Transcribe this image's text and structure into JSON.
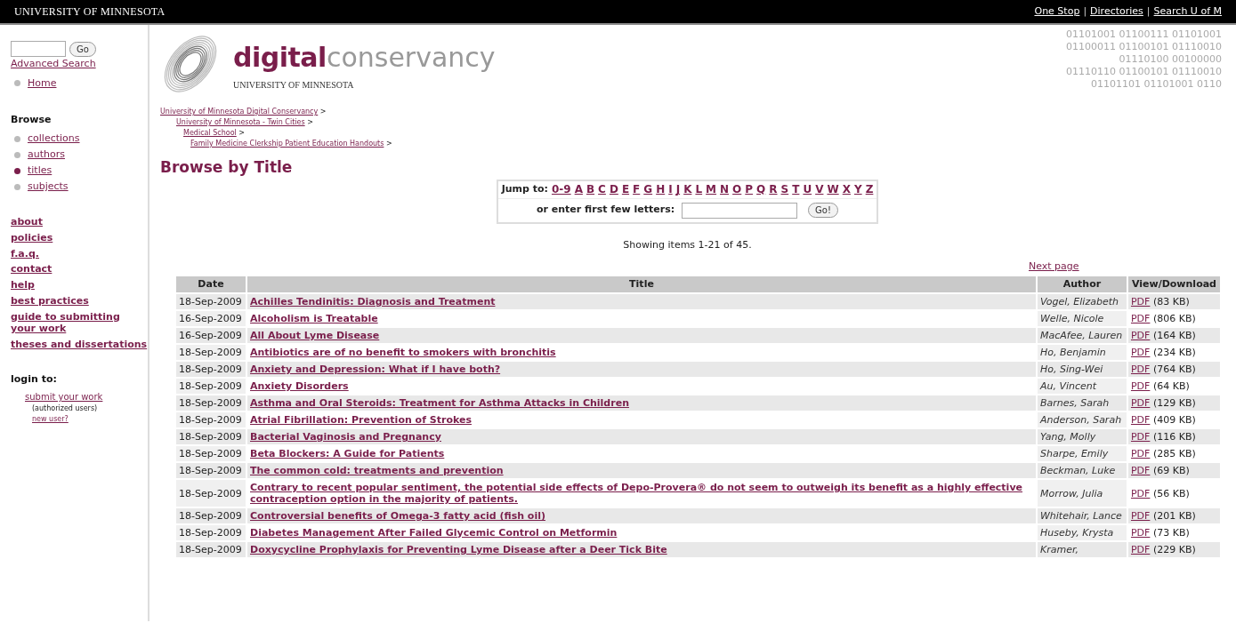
{
  "top_bar": {
    "title": "UNIVERSITY OF MINNESOTA",
    "links": [
      "One Stop",
      "Directories",
      "Search U of M"
    ],
    "separator": "|"
  },
  "sidebar": {
    "search_button": "Go",
    "advanced_search": "Advanced Search",
    "home": [
      {
        "label": "Home",
        "selected": false
      }
    ],
    "browse_heading": "Browse",
    "browse_items": [
      {
        "label": "collections",
        "selected": false
      },
      {
        "label": "authors",
        "selected": false
      },
      {
        "label": "titles",
        "selected": true
      },
      {
        "label": "subjects",
        "selected": false
      }
    ],
    "links": [
      "about",
      "policies",
      "f.a.q.",
      "contact",
      "help",
      "best practices",
      "guide to submitting your work",
      "theses and dissertations"
    ],
    "login_heading": "login to:",
    "submit_link": "submit your work",
    "submit_note": "(authorized users)",
    "new_user": "new user?"
  },
  "header": {
    "logo_bold": "digital",
    "logo_light": "conservancy",
    "logo_sub": "UNIVERSITY OF MINNESOTA",
    "binary_lines": [
      "01101001 01100111 01101001",
      "01100011 01100101 01110010",
      "01110100 00100000",
      "01110110 01100101 01110010",
      "01101101 01101001 0110"
    ]
  },
  "breadcrumbs": [
    {
      "label": "University of Minnesota Digital Conservancy",
      "suffix": ">"
    },
    {
      "label": "University of Minnesota - Twin Cities",
      "suffix": ">"
    },
    {
      "label": "Medical School",
      "suffix": ">"
    },
    {
      "label": "Family Medicine Clerkship Patient Education Handouts",
      "suffix": ">"
    }
  ],
  "page_title": "Browse by Title",
  "jump": {
    "label": "Jump to:",
    "letters": [
      "0-9",
      "A",
      "B",
      "C",
      "D",
      "E",
      "F",
      "G",
      "H",
      "I",
      "J",
      "K",
      "L",
      "M",
      "N",
      "O",
      "P",
      "Q",
      "R",
      "S",
      "T",
      "U",
      "V",
      "W",
      "X",
      "Y",
      "Z"
    ],
    "enter_label": "or enter first few letters:",
    "go_button": "Go!"
  },
  "showing": "Showing items 1-21 of 45.",
  "next_page": "Next page",
  "table": {
    "columns": [
      "Date",
      "Title",
      "Author",
      "View/Download"
    ],
    "rows": [
      {
        "date": "18-Sep-2009",
        "title": "Achilles Tendinitis: Diagnosis and Treatment",
        "author": "Vogel, Elizabeth",
        "link": "PDF",
        "size": "(83 KB)"
      },
      {
        "date": "16-Sep-2009",
        "title": "Alcoholism is Treatable",
        "author": "Welle, Nicole",
        "link": "PDF",
        "size": "(806 KB)"
      },
      {
        "date": "16-Sep-2009",
        "title": "All About Lyme Disease",
        "author": "MacAfee, Lauren",
        "link": "PDF",
        "size": "(164 KB)"
      },
      {
        "date": "18-Sep-2009",
        "title": "Antibiotics are of no benefit to smokers with bronchitis",
        "author": "Ho, Benjamin",
        "link": "PDF",
        "size": "(234 KB)"
      },
      {
        "date": "18-Sep-2009",
        "title": "Anxiety and Depression: What if I have both?",
        "author": "Ho, Sing-Wei",
        "link": "PDF",
        "size": "(764 KB)"
      },
      {
        "date": "18-Sep-2009",
        "title": "Anxiety Disorders",
        "author": "Au, Vincent",
        "link": "PDF",
        "size": "(64 KB)"
      },
      {
        "date": "18-Sep-2009",
        "title": "Asthma and Oral Steroids: Treatment for Asthma Attacks in Children",
        "author": "Barnes, Sarah",
        "link": "PDF",
        "size": "(129 KB)"
      },
      {
        "date": "18-Sep-2009",
        "title": "Atrial Fibrillation: Prevention of Strokes",
        "author": "Anderson, Sarah",
        "link": "PDF",
        "size": "(409 KB)"
      },
      {
        "date": "18-Sep-2009",
        "title": "Bacterial Vaginosis and Pregnancy",
        "author": "Yang, Molly",
        "link": "PDF",
        "size": "(116 KB)"
      },
      {
        "date": "18-Sep-2009",
        "title": "Beta Blockers: A Guide for Patients",
        "author": "Sharpe, Emily",
        "link": "PDF",
        "size": "(285 KB)"
      },
      {
        "date": "18-Sep-2009",
        "title": "The common cold: treatments and prevention",
        "author": "Beckman, Luke",
        "link": "PDF",
        "size": "(69 KB)"
      },
      {
        "date": "18-Sep-2009",
        "title": "Contrary to recent popular sentiment, the potential side effects of Depo-Provera® do not seem to outweigh its benefit as a highly effective contraception option in the majority of patients.",
        "author": "Morrow, Julia",
        "link": "PDF",
        "size": "(56 KB)"
      },
      {
        "date": "18-Sep-2009",
        "title": "Controversial benefits of Omega-3 fatty acid (fish oil)",
        "author": "Whitehair, Lance",
        "link": "PDF",
        "size": "(201 KB)"
      },
      {
        "date": "18-Sep-2009",
        "title": "Diabetes Management After Failed Glycemic Control on Metformin",
        "author": "Huseby, Krysta",
        "link": "PDF",
        "size": "(73 KB)"
      },
      {
        "date": "18-Sep-2009",
        "title": "Doxycycline Prophylaxis for Preventing Lyme Disease after a Deer Tick Bite",
        "author": "Kramer,",
        "link": "PDF",
        "size": "(229 KB)"
      }
    ]
  }
}
